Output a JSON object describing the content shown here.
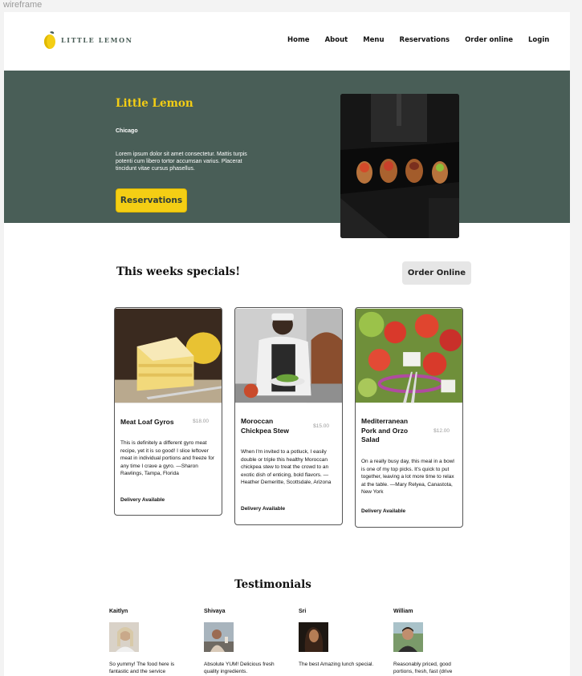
{
  "frame_label": "wireframe",
  "brand": {
    "name": "LITTLE LEMON",
    "accent": "#f4ce14",
    "primary": "#495e57"
  },
  "nav": [
    {
      "label": "Home"
    },
    {
      "label": "About"
    },
    {
      "label": "Menu"
    },
    {
      "label": "Reservations"
    },
    {
      "label": "Order online"
    },
    {
      "label": "Login"
    }
  ],
  "hero": {
    "title": "Little Lemon",
    "city": "Chicago",
    "description": "Lorem ipsum dolor sit amet consectetur. Mattis turpis potenti cum libero tortor accumsan varius. Placerat tincidunt vitae cursus phasellus.",
    "button_label": "Reservations"
  },
  "specials": {
    "title": "This weeks specials!",
    "order_button_label": "Order Online",
    "cards": [
      {
        "name": "Meat Loaf Gyros",
        "price": "$18.00",
        "description": "This is definitely a different gyro meat recipe, yet it is so good! I slice leftover meat in individual portions and freeze for any time I crave a gyro. —Sharon Rawlings, Tampa, Florida",
        "delivery": "Delivery Available"
      },
      {
        "name": "Moroccan Chickpea Stew",
        "price": "$15.00",
        "description": "When I'm invited to a potluck, I easily double or triple this healthy Moroccan chickpea stew to treat the crowd to an exotic dish of enticing, bold flavors. —Heather Demeritte, Scottsdale, Arizona",
        "delivery": "Delivery Available"
      },
      {
        "name": "Mediterranean Pork and Orzo Salad",
        "price": "$12.00",
        "description": "On a really busy day, this meal in a bowl is one of my top picks. It's quick to put together, leaving a lot more time to relax at the table. —Mary Relyea, Canastota, New York",
        "delivery": "Delivery Available"
      }
    ]
  },
  "testimonials": {
    "title": "Testimonials",
    "items": [
      {
        "name": "Kaitlyn",
        "text": "So yummy! The food here is fantastic and the service"
      },
      {
        "name": "Shivaya",
        "text": "Absolute YUM! Delicious fresh quality ingredients."
      },
      {
        "name": "Sri",
        "text": "The best Amazing lunch special."
      },
      {
        "name": "William",
        "text": "Reasonably priced, good portions, fresh, fast (drive"
      }
    ]
  }
}
